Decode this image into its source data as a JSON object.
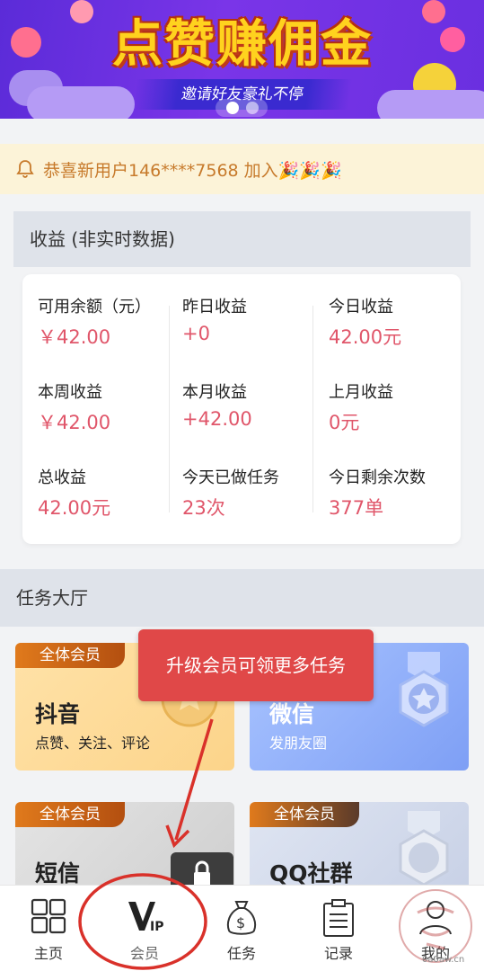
{
  "banner": {
    "title": "点赞赚佣金",
    "subtitle": "邀请好友豪礼不停"
  },
  "notice": {
    "text": "恭喜新用户146****7568 加入🎉🎉🎉"
  },
  "income": {
    "header": "收益 (非实时数据)",
    "stats": [
      {
        "label": "可用余额（元）",
        "value": "￥42.00"
      },
      {
        "label": "昨日收益",
        "value": "+0"
      },
      {
        "label": "今日收益",
        "value": "42.00元"
      },
      {
        "label": "本周收益",
        "value": "￥42.00"
      },
      {
        "label": "本月收益",
        "value": "+42.00"
      },
      {
        "label": "上月收益",
        "value": "0元"
      },
      {
        "label": "总收益",
        "value": "42.00元"
      },
      {
        "label": "今天已做任务",
        "value": "23次"
      },
      {
        "label": "今日剩余次数",
        "value": "377单"
      }
    ]
  },
  "hall": {
    "header": "任务大厅",
    "tooltip": "升级会员可领更多任务",
    "tasks": [
      {
        "tag": "全体会员",
        "title": "抖音",
        "subtitle": "点赞、关注、评论"
      },
      {
        "tag": "",
        "title": "微信",
        "subtitle": "发朋友圈"
      },
      {
        "tag": "全体会员",
        "title": "短信",
        "subtitle": ""
      },
      {
        "tag": "全体会员",
        "title": "QQ社群",
        "subtitle": ""
      }
    ]
  },
  "nav": [
    {
      "label": "主页",
      "icon": "grid-icon"
    },
    {
      "label": "会员",
      "icon": "vip-icon"
    },
    {
      "label": "任务",
      "icon": "money-bag-icon"
    },
    {
      "label": "记录",
      "icon": "clipboard-icon"
    },
    {
      "label": "我的",
      "icon": "person-icon"
    }
  ],
  "watermark": "0a0aw.cn",
  "colors": {
    "value_red": "#e0566a",
    "notice_text": "#c77a2b",
    "tooltip_bg": "#e04848",
    "annotation_red": "#d9312a"
  }
}
